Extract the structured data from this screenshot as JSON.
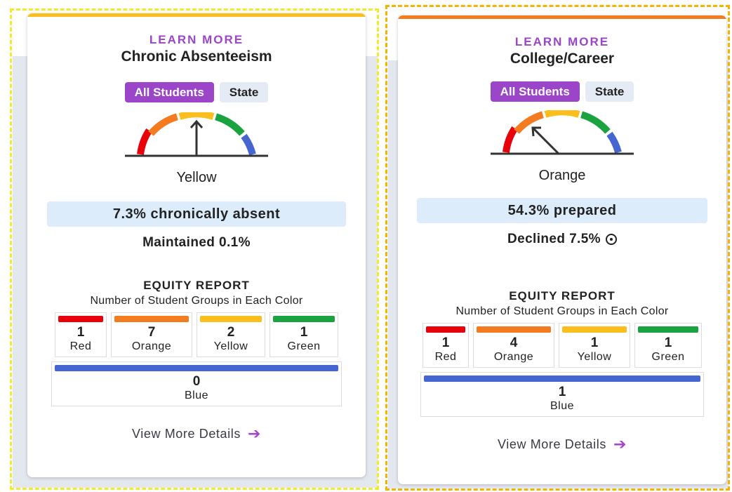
{
  "colors": {
    "red": "#e8000b",
    "orange": "#f47b20",
    "yellow": "#fbbf1d",
    "green": "#1aa33f",
    "blue": "#4566d0",
    "purple": "#9b45c8",
    "status_bg": "#dcecfb",
    "band_bg": "#e3e8ef"
  },
  "cards": [
    {
      "accent": "#fbbf1d",
      "learn_more": "LEARN MORE",
      "title": "Chronic Absenteeism",
      "pill_all": "All Students",
      "pill_state": "State",
      "gauge_level": "yellow",
      "gauge_label": "Yellow",
      "status": "7.3% chronically absent",
      "change": "Maintained 0.1%",
      "change_icon": "",
      "equity_title": "EQUITY REPORT",
      "equity_subtitle": "Number of Student Groups in Each Color",
      "groups": [
        {
          "count": "1",
          "name": "Red",
          "color": "#e8000b"
        },
        {
          "count": "7",
          "name": "Orange",
          "color": "#f47b20"
        },
        {
          "count": "2",
          "name": "Yellow",
          "color": "#fbbf1d"
        },
        {
          "count": "1",
          "name": "Green",
          "color": "#1aa33f"
        }
      ],
      "blue_group": {
        "count": "0",
        "name": "Blue",
        "color": "#4566d0"
      },
      "view_details": "View More Details",
      "arrow_icon": "arrow-right-icon"
    },
    {
      "accent": "#f47b20",
      "learn_more": "LEARN MORE",
      "title": "College/Career",
      "pill_all": "All Students",
      "pill_state": "State",
      "gauge_level": "orange",
      "gauge_label": "Orange",
      "status": "54.3% prepared",
      "change": "Declined 7.5%",
      "change_icon": "info-icon",
      "equity_title": "EQUITY REPORT",
      "equity_subtitle": "Number of Student Groups in Each Color",
      "groups": [
        {
          "count": "1",
          "name": "Red",
          "color": "#e8000b"
        },
        {
          "count": "4",
          "name": "Orange",
          "color": "#f47b20"
        },
        {
          "count": "1",
          "name": "Yellow",
          "color": "#fbbf1d"
        },
        {
          "count": "1",
          "name": "Green",
          "color": "#1aa33f"
        }
      ],
      "blue_group": {
        "count": "1",
        "name": "Blue",
        "color": "#4566d0"
      },
      "view_details": "View More Details",
      "arrow_icon": "arrow-right-icon"
    }
  ]
}
